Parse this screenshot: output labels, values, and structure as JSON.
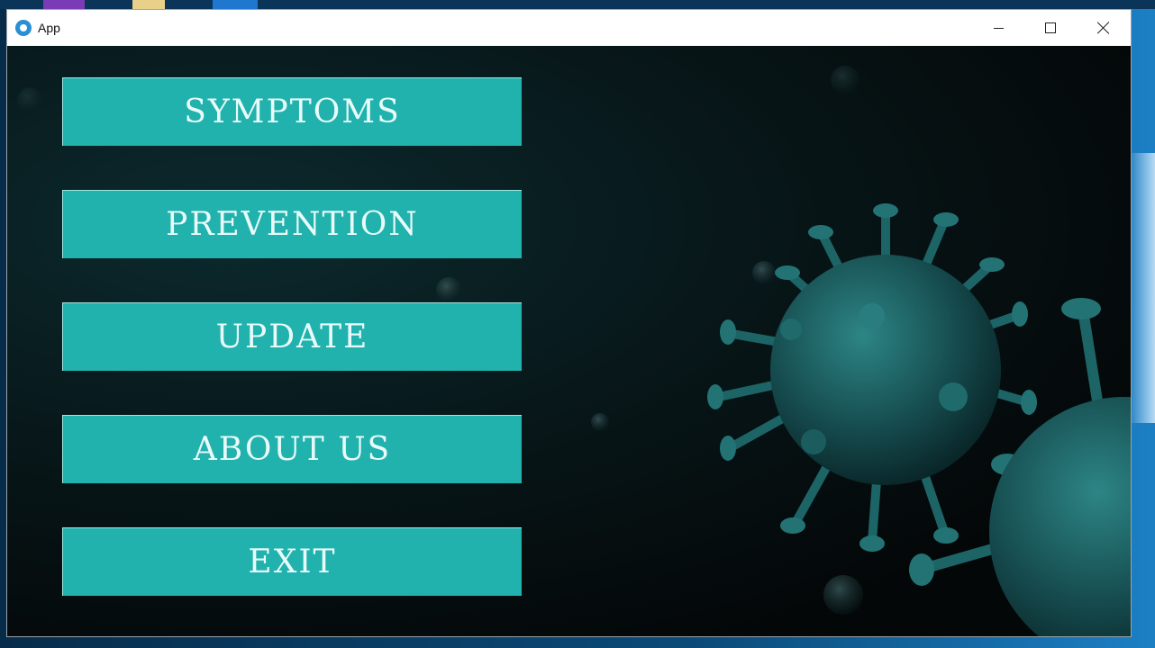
{
  "window": {
    "title": "App",
    "icon": "app-gear-icon"
  },
  "window_controls": {
    "minimize_icon": "minimize-icon",
    "maximize_icon": "maximize-icon",
    "close_icon": "close-icon"
  },
  "menu": {
    "symptoms_label": "SYMPTOMS",
    "prevention_label": "PREVENTION",
    "update_label": "UPDATE",
    "about_label": "ABOUT US",
    "exit_label": "EXIT"
  },
  "colors": {
    "button_bg": "#21b2ad",
    "button_text": "#e8fbfa",
    "content_bg": "#050809",
    "virus": "#1f6f70"
  }
}
